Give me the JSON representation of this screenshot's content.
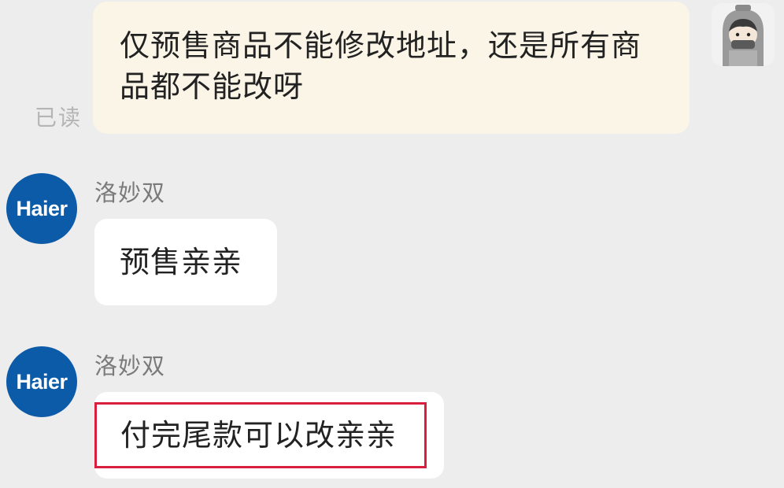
{
  "outgoing": {
    "text": "仅预售商品不能修改地址，还是所有商品都不能改呀",
    "read_status": "已读"
  },
  "incoming": [
    {
      "sender": "洛妙双",
      "avatar_text": "Haier",
      "text": "预售亲亲"
    },
    {
      "sender": "洛妙双",
      "avatar_text": "Haier",
      "text": "付完尾款可以改亲亲",
      "highlighted": true
    }
  ],
  "colors": {
    "background": "#ededed",
    "outgoing_bubble": "#fbf5e8",
    "incoming_bubble": "#ffffff",
    "brand_avatar": "#0b5ba9",
    "highlight_border": "#d8203e"
  }
}
